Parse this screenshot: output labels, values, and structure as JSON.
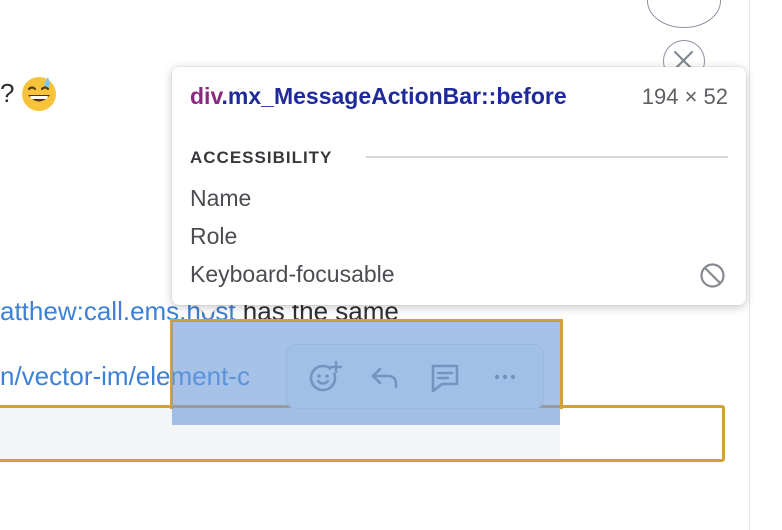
{
  "chat": {
    "line1_text": "?",
    "line2_link": "atthew:call.ems.host",
    "line2_text": " has the same",
    "line3_link": "n/vector-im/element-c"
  },
  "action_bar": {
    "icons": [
      "react-icon",
      "reply-icon",
      "thread-icon",
      "options-icon"
    ]
  },
  "inspector": {
    "tag": "div",
    "selector": ".mx_MessageActionBar::before",
    "size": "194 × 52",
    "section_title": "ACCESSIBILITY",
    "rows": [
      "Name",
      "Role",
      "Keyboard-focusable"
    ],
    "keyboard_focusable_icon": "not-allowed-icon"
  },
  "colors": {
    "link": "#3d80d6",
    "highlight": "#6f9ddc",
    "hover_outline": "#d4a037",
    "tag": "#8a2a7f",
    "selector": "#1f2a9a"
  }
}
